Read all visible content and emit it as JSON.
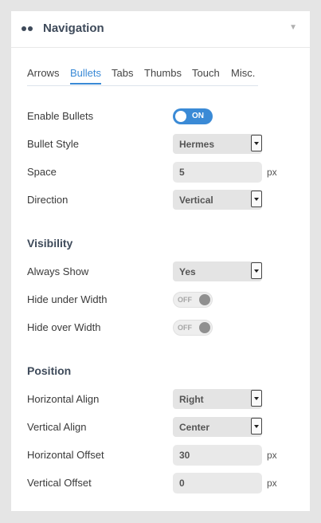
{
  "header": {
    "title": "Navigation",
    "icon": "dots-icon",
    "toggle_icon": "chevron-down-icon"
  },
  "tabs": [
    {
      "label": "Arrows",
      "active": false
    },
    {
      "label": "Bullets",
      "active": true
    },
    {
      "label": "Tabs",
      "active": false
    },
    {
      "label": "Thumbs",
      "active": false
    },
    {
      "label": "Touch",
      "active": false
    },
    {
      "label": "Misc.",
      "active": false
    }
  ],
  "bullets": {
    "enable": {
      "label": "Enable Bullets",
      "state": "ON"
    },
    "style": {
      "label": "Bullet Style",
      "value": "Hermes"
    },
    "space": {
      "label": "Space",
      "value": "5",
      "unit": "px"
    },
    "direction": {
      "label": "Direction",
      "value": "Vertical"
    }
  },
  "visibility": {
    "title": "Visibility",
    "always_show": {
      "label": "Always Show",
      "value": "Yes"
    },
    "hide_under": {
      "label": "Hide under Width",
      "state": "OFF"
    },
    "hide_over": {
      "label": "Hide over Width",
      "state": "OFF"
    }
  },
  "position": {
    "title": "Position",
    "h_align": {
      "label": "Horizontal Align",
      "value": "Right"
    },
    "v_align": {
      "label": "Vertical Align",
      "value": "Center"
    },
    "h_offset": {
      "label": "Horizontal Offset",
      "value": "30",
      "unit": "px"
    },
    "v_offset": {
      "label": "Vertical Offset",
      "value": "0",
      "unit": "px"
    }
  },
  "colors": {
    "accent": "#3a8ad6",
    "heading": "#3e4a5a",
    "background": "#e5e5e5"
  }
}
